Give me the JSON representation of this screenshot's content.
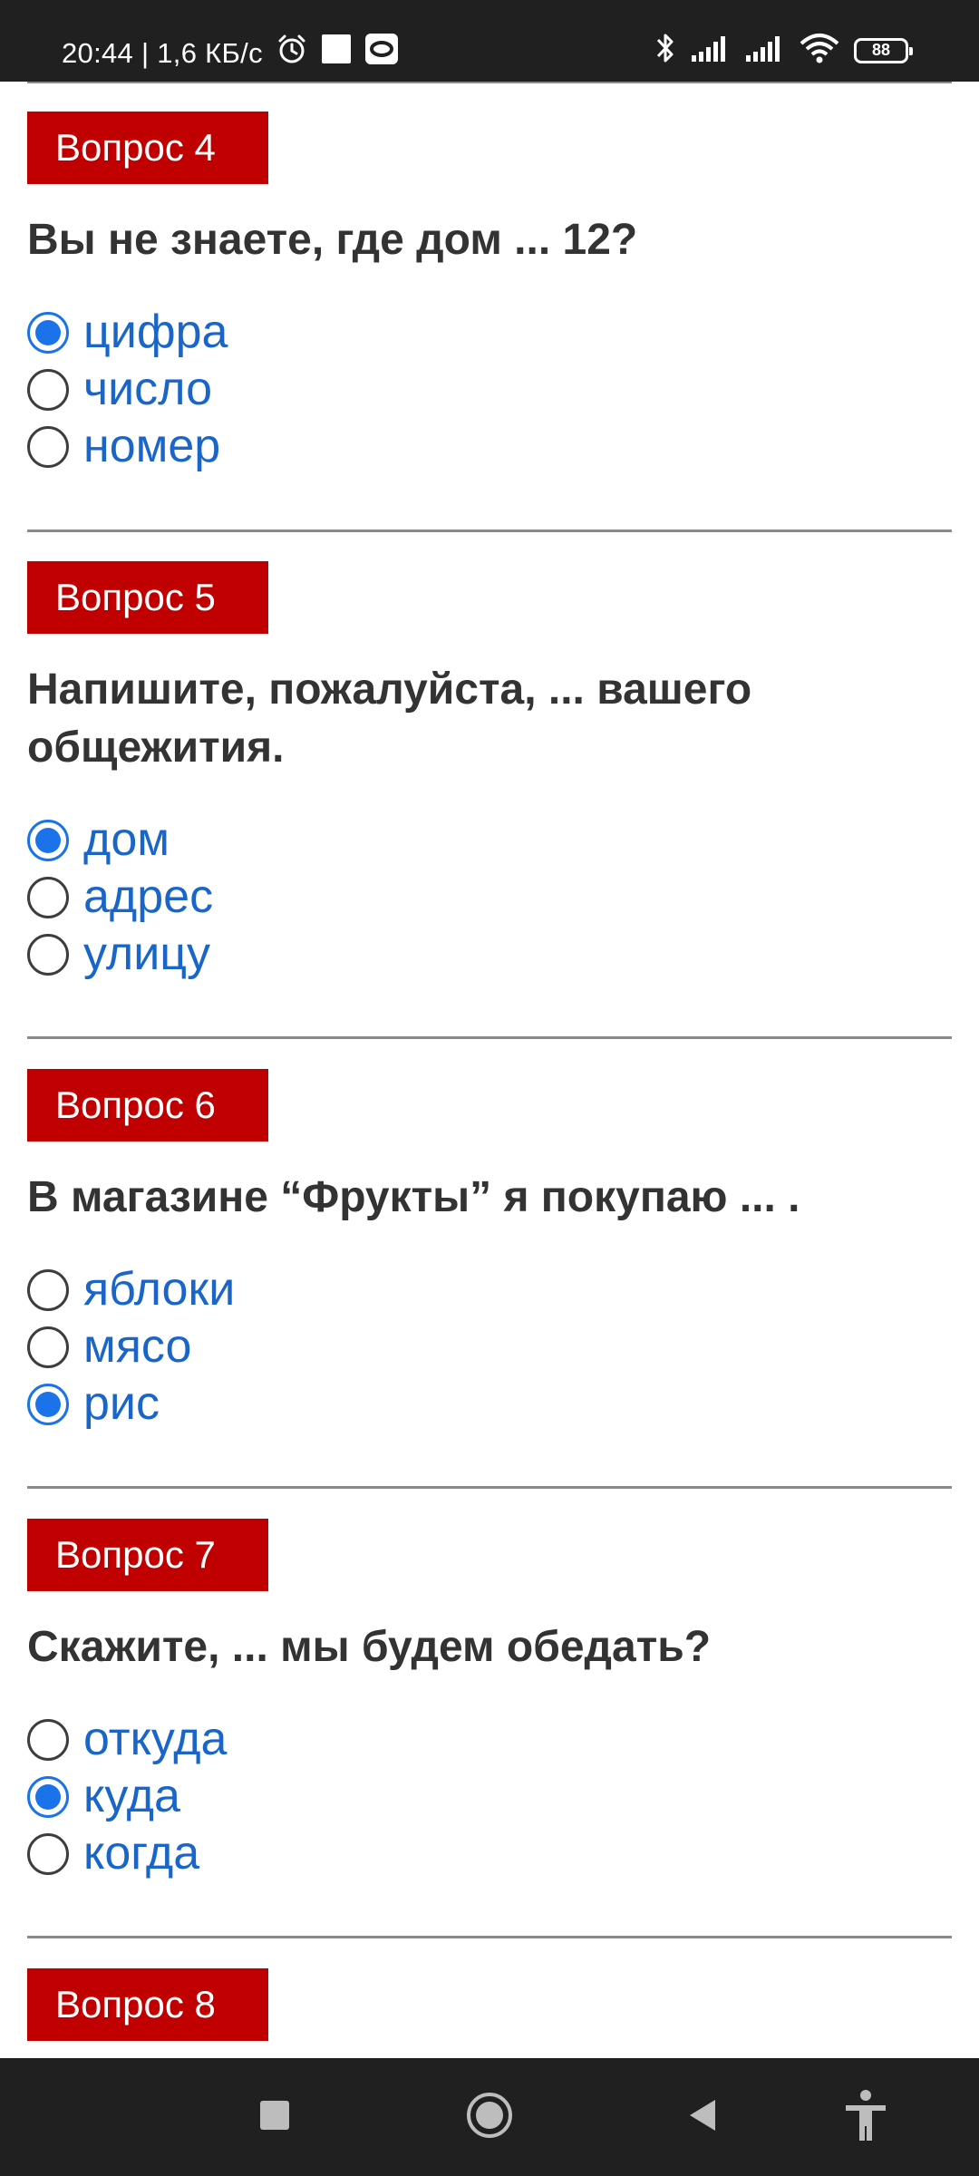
{
  "status_bar": {
    "time": "20:44 | 1,6 КБ/с",
    "battery": "88"
  },
  "questions": [
    {
      "badge": "Вопрос 4",
      "text": "Вы не знаете, где дом ... 12?",
      "options": [
        "цифра",
        "число",
        "номер"
      ],
      "selected": 0
    },
    {
      "badge": "Вопрос 5",
      "text": "Напишите, пожалуйста, ... вашего общежития.",
      "options": [
        "дом",
        "адрес",
        "улицу"
      ],
      "selected": 0
    },
    {
      "badge": "Вопрос 6",
      "text": "В магазине “Фрукты” я покупаю ... .",
      "options": [
        "яблоки",
        "мясо",
        "рис"
      ],
      "selected": 2
    },
    {
      "badge": "Вопрос 7",
      "text": "Скажите, ... мы будем обедать?",
      "options": [
        "откуда",
        "куда",
        "когда"
      ],
      "selected": 1
    },
    {
      "badge": "Вопрос 8",
      "text": "",
      "options": [],
      "selected": null
    }
  ],
  "icons": {
    "status_left": [
      "alarm-icon",
      "square-notification-icon",
      "screen-record-icon"
    ],
    "status_right": [
      "bluetooth-icon",
      "signal-icon",
      "signal-icon",
      "wifi-icon",
      "battery-icon"
    ],
    "nav": [
      "recents-square-icon",
      "home-circle-icon",
      "back-triangle-icon",
      "accessibility-icon"
    ]
  }
}
